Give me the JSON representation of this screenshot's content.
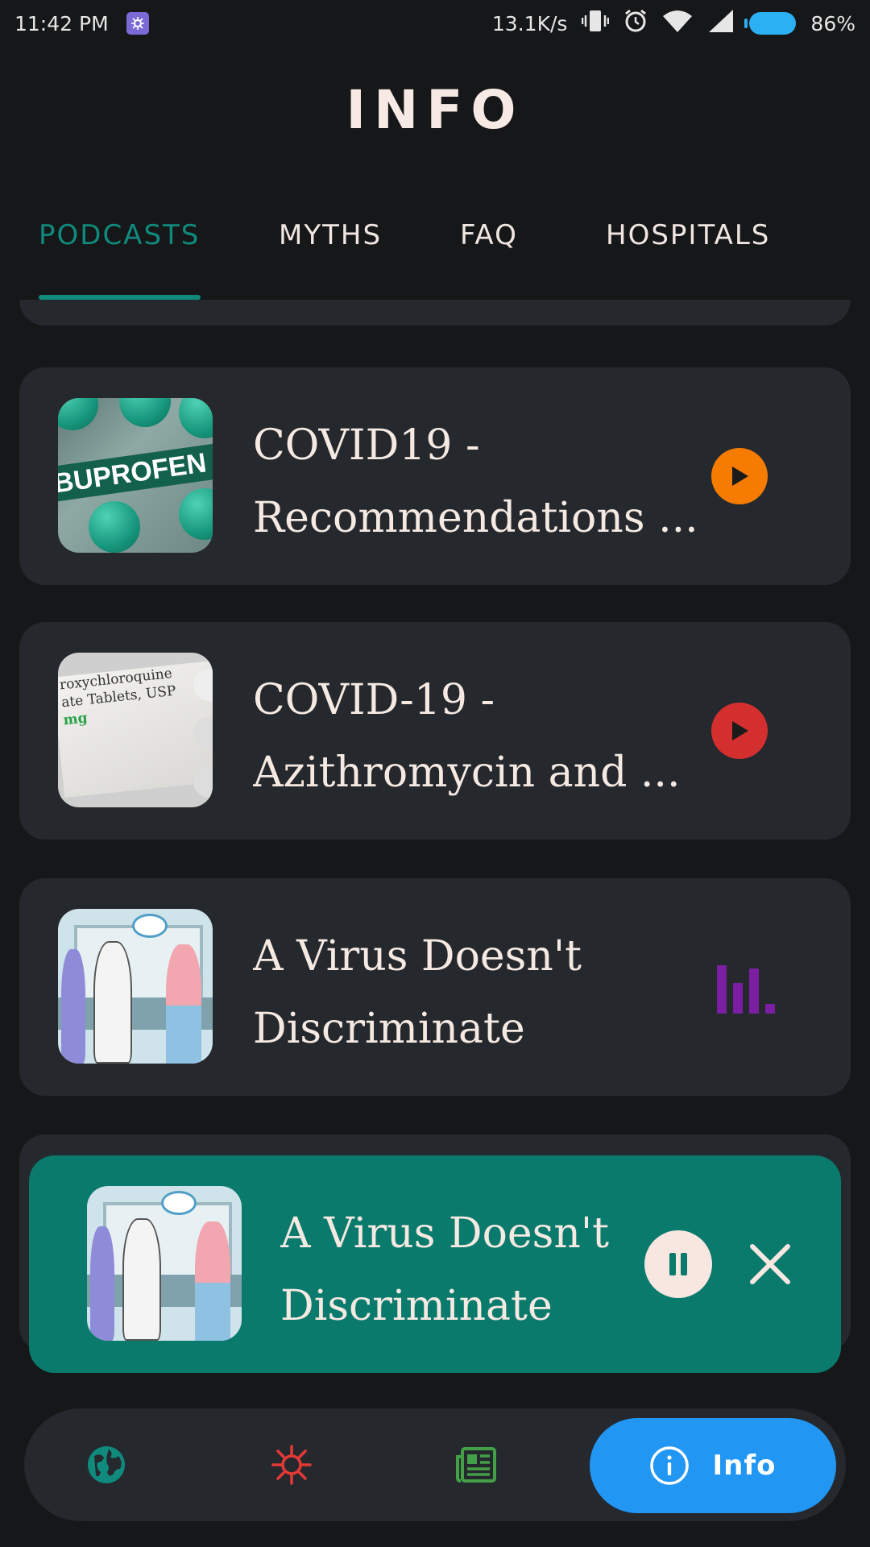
{
  "status_bar": {
    "time": "11:42 PM",
    "network_speed": "13.1K/s",
    "battery": "86%",
    "icons": [
      "app-notification-icon",
      "vibrate-icon",
      "alarm-icon",
      "wifi-icon",
      "signal-icon",
      "battery-icon"
    ]
  },
  "header": {
    "title": "INFO"
  },
  "tabs": [
    {
      "label": "PODCASTS",
      "active": true
    },
    {
      "label": "MYTHS",
      "active": false
    },
    {
      "label": "FAQ",
      "active": false
    },
    {
      "label": "HOSPITALS",
      "active": false
    }
  ],
  "podcasts": [
    {
      "title_line1": "COVID19 -",
      "title_line2": "Recommendations ...",
      "thumbnail": "ibuprofen-tablets",
      "button": "play",
      "button_color": "#f57c00"
    },
    {
      "title_line1": "COVID-19 -",
      "title_line2": "Azithromycin and ...",
      "thumbnail": "hydroxychloroquine-box",
      "button": "play",
      "button_color": "#d32f2f",
      "thumb_text_line1": "roxychloroquine",
      "thumb_text_line2": "ate Tablets, USP",
      "thumb_text_line3": "mg"
    },
    {
      "title_line1": "A Virus Doesn't",
      "title_line2": "Discriminate",
      "thumbnail": "virus-discrimination-illustration",
      "button": "equalizer",
      "button_color": "#7b1fa2"
    }
  ],
  "thumb_ibuprofen_text": "BUPROFEN",
  "now_playing": {
    "title_line1": "A Virus Doesn't",
    "title_line2": "Discriminate",
    "thumbnail": "virus-discrimination-illustration",
    "background": "#0a7a6d"
  },
  "bottom_nav": {
    "items": [
      {
        "icon": "globe-icon",
        "color": "#0f8a7d"
      },
      {
        "icon": "virus-icon",
        "color": "#e53935"
      },
      {
        "icon": "news-icon",
        "color": "#43a047"
      }
    ],
    "active": {
      "icon": "info-icon",
      "label": "Info",
      "color": "#2196f3"
    }
  },
  "colors": {
    "accent": "#0f8a7d",
    "background": "#161719",
    "card": "#25282d",
    "text": "#f5e9e2"
  }
}
